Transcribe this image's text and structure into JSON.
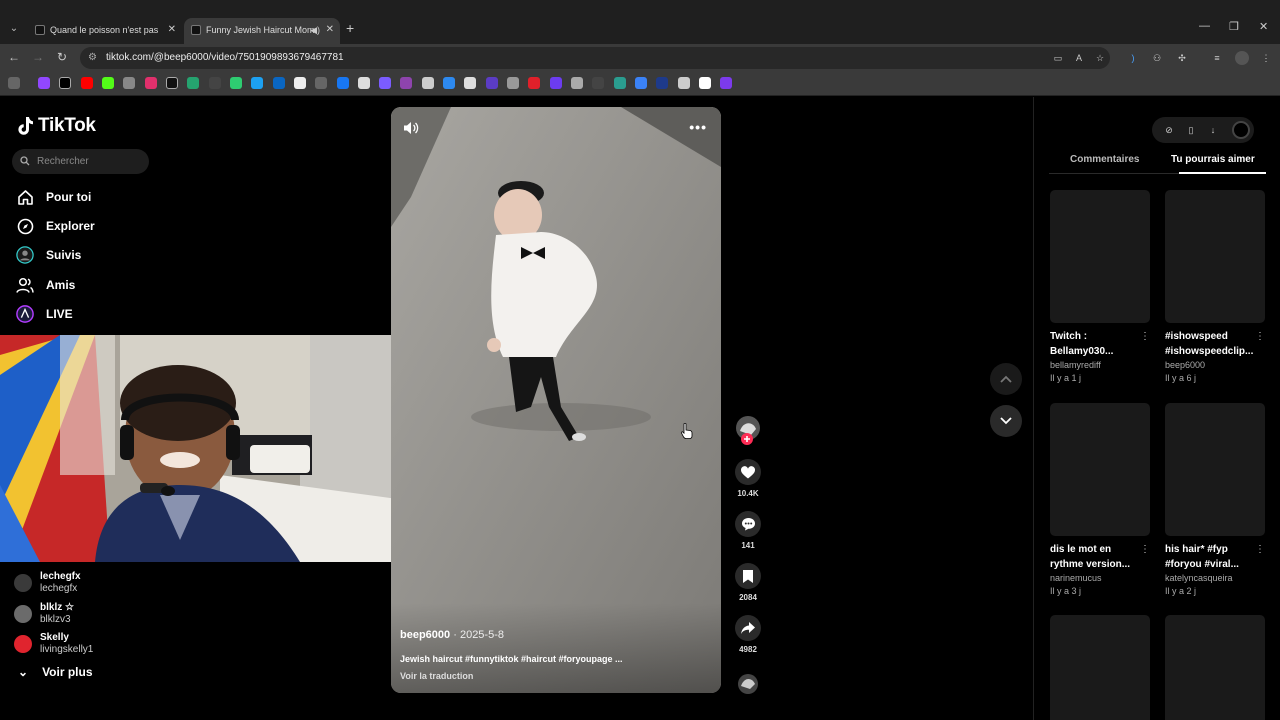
{
  "browser": {
    "tabs": [
      {
        "title": "Quand le poisson n'est pas dans",
        "active": false
      },
      {
        "title": "Funny Jewish Haircut Mome",
        "active": true
      }
    ],
    "url": "tiktok.com/@beep6000/video/7501909893679467781"
  },
  "tiktok": {
    "logo_text": "TikTok",
    "search_placeholder": "Rechercher",
    "nav": [
      {
        "label": "Pour toi",
        "icon": "home-icon"
      },
      {
        "label": "Explorer",
        "icon": "compass-icon"
      },
      {
        "label": "Suivis",
        "icon": "following-icon"
      },
      {
        "label": "Amis",
        "icon": "friends-icon"
      },
      {
        "label": "LIVE",
        "icon": "live-icon"
      }
    ],
    "following_accounts": [
      {
        "name": "lechegfx",
        "handle": "lechegfx"
      },
      {
        "name": "blklz ☆",
        "handle": "blklzv3"
      },
      {
        "name": "Skelly",
        "handle": "livingskelly1"
      }
    ],
    "see_more": "Voir plus",
    "video": {
      "author": "beep6000",
      "date": "2025-5-8",
      "caption": "Jewish haircut #funnytiktok #haircut #foryoupage ...",
      "translate": "Voir la traduction"
    },
    "actions": {
      "likes": "10.4K",
      "comments": "141",
      "saves": "2084",
      "shares": "4982"
    },
    "right_panel": {
      "tabs": [
        "Commentaires",
        "Tu pourrais aimer"
      ],
      "active_tab": "Tu pourrais aimer",
      "recommendations": [
        {
          "title": "Twitch : Bellamy030...",
          "user": "bellamyrediff",
          "time": "Il y a 1 j"
        },
        {
          "title": "#ishowspeed #ishowspeedclip...",
          "user": "beep6000",
          "time": "Il y a 6 j"
        },
        {
          "title": "dis le mot en rythme version...",
          "user": "narinemucus",
          "time": "Il y a 3 j"
        },
        {
          "title": "his hair* #fyp #foryou #viral...",
          "user": "katelyncasqueira",
          "time": "Il y a 2 j"
        }
      ]
    }
  }
}
